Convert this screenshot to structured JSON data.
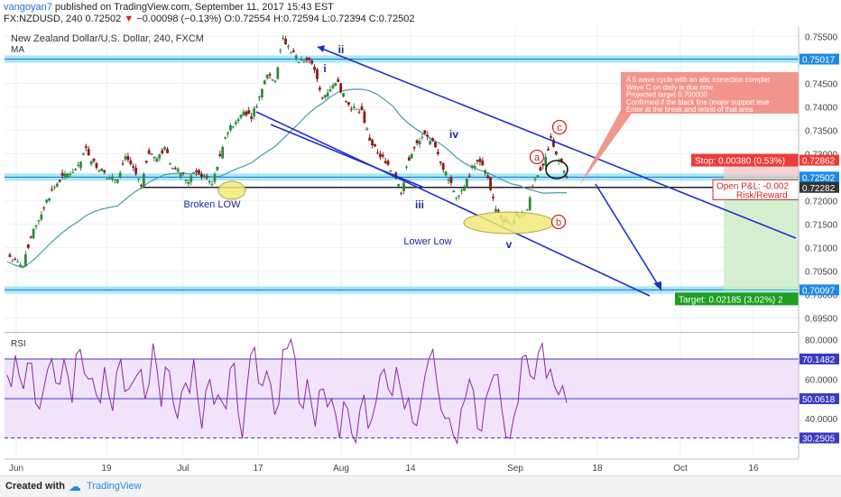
{
  "header": {
    "user": "vangoyan7",
    "published_text": "published on TradingView.com, September 11, 2017 15:43 EST",
    "symbol": "FX:NZDUSD, 240",
    "last": "0.72502",
    "change": "−0.00098 (−0.13%)",
    "ohlc": "O:0.72554 H:0.72594 L:0.72394 C:0.72502"
  },
  "pane_title": "New Zealand Dollar/U.S. Dollar, 240, FXCM",
  "ma_label": "MA",
  "rsi_label": "RSI",
  "footer": {
    "created_with": "Created with",
    "brand": "TradingView"
  },
  "colors": {
    "candle_up": "#2b8a3e",
    "candle_down": "#8b1a1a",
    "ma_line": "#4a9aa8",
    "channel": "#1f2fcc",
    "highlight_band": "#63d3f2",
    "rsi_line": "#8a2a9a",
    "rsi_fill": "#f1e3fb",
    "wave_label": "#1a2a9a",
    "abc_circle": "#c62828",
    "note_bg": "#f28b82",
    "stop_tag": "#ef3a3a",
    "target_tag": "#1e9e1e",
    "ellipse": "#f3ea7a"
  },
  "chart_data": {
    "type": "candlestick",
    "title": "New Zealand Dollar/U.S. Dollar, 240, FXCM",
    "x_ticks": [
      "Jun",
      "19",
      "Jul",
      "17",
      "Aug",
      "14",
      "Sep",
      "18",
      "Oct",
      "16"
    ],
    "y_ticks": [
      "0.75500",
      "0.75000",
      "0.74500",
      "0.74000",
      "0.73500",
      "0.73000",
      "0.72500",
      "0.72000",
      "0.71500",
      "0.71000",
      "0.70500",
      "0.70000",
      "0.69500"
    ],
    "ylim": [
      0.6922,
      0.757
    ],
    "close_path": [
      0.7085,
      0.707,
      0.706,
      0.712,
      0.716,
      0.72,
      0.723,
      0.725,
      0.726,
      0.727,
      0.731,
      0.728,
      0.7265,
      0.7245,
      0.725,
      0.7295,
      0.727,
      0.723,
      0.73,
      0.729,
      0.731,
      0.727,
      0.726,
      0.724,
      0.7265,
      0.725,
      0.724,
      0.729,
      0.735,
      0.737,
      0.739,
      0.738,
      0.742,
      0.747,
      0.746,
      0.7545,
      0.752,
      0.75,
      0.7505,
      0.748,
      0.742,
      0.744,
      0.745,
      0.741,
      0.7395,
      0.739,
      0.733,
      0.73,
      0.7285,
      0.726,
      0.722,
      0.729,
      0.732,
      0.734,
      0.7325,
      0.728,
      0.725,
      0.721,
      0.723,
      0.727,
      0.7285,
      0.725,
      0.718,
      0.716,
      0.715,
      0.717,
      0.718,
      0.725,
      0.7275,
      0.733,
      0.729,
      0.725
    ],
    "price_labels": [
      {
        "label": "0.75017",
        "value": 0.75017,
        "style": "band"
      },
      {
        "label": "0.72862",
        "value": 0.72862,
        "style": "stop"
      },
      {
        "label": "0.72502",
        "value": 0.72502,
        "style": "band"
      },
      {
        "label": "0.72282",
        "value": 0.72282,
        "style": "dark"
      },
      {
        "label": "0.70097",
        "value": 0.70097,
        "style": "band"
      }
    ],
    "horizontal_lines": [
      0.75017,
      0.72502,
      0.70097
    ],
    "black_support_line": 0.72282,
    "wave_labels": [
      "i",
      "ii",
      "iii",
      "iv",
      "v"
    ],
    "abc_labels": [
      "a",
      "b",
      "c"
    ],
    "text_annotations": [
      "Broken LOW",
      "Lower Low"
    ],
    "note_lines": [
      "A 5 wave cycle with an abc correction complet",
      "Wave C on daily is due now.",
      "Projected target 0.700000",
      "Confirmed if the black line (major support leve",
      "Enter at the break and retest of that area"
    ],
    "position_tool": {
      "stop": "Stop: 0.00380 (0.53%)",
      "open_pnl": "Open P&L: -0.002",
      "risk_reward": "Risk/Reward",
      "target": "Target: 0.02185 (3.02%) 2"
    },
    "rsi": {
      "ylim": [
        20,
        82
      ],
      "y_ticks": [
        "80.0000",
        "60.0000",
        "40.0000"
      ],
      "levels": [
        {
          "label": "70.1482",
          "value": 70.1482
        },
        {
          "label": "50.0618",
          "value": 50.0618
        },
        {
          "label": "30.2505",
          "value": 30.2505
        }
      ],
      "values": [
        62,
        72,
        55,
        68,
        45,
        65,
        58,
        70,
        48,
        75,
        60,
        52,
        66,
        44,
        70,
        55,
        62,
        50,
        78,
        46,
        64,
        40,
        58,
        70,
        35,
        60,
        52,
        45,
        68,
        30,
        72,
        58,
        64,
        42,
        75,
        80,
        48,
        60,
        36,
        55,
        50,
        30,
        45,
        28,
        52,
        40,
        62,
        55,
        66,
        45,
        38,
        48,
        70,
        58,
        40,
        32,
        45,
        60,
        35,
        50,
        62,
        45,
        30,
        48,
        72,
        60,
        78,
        65,
        52,
        48
      ]
    }
  }
}
